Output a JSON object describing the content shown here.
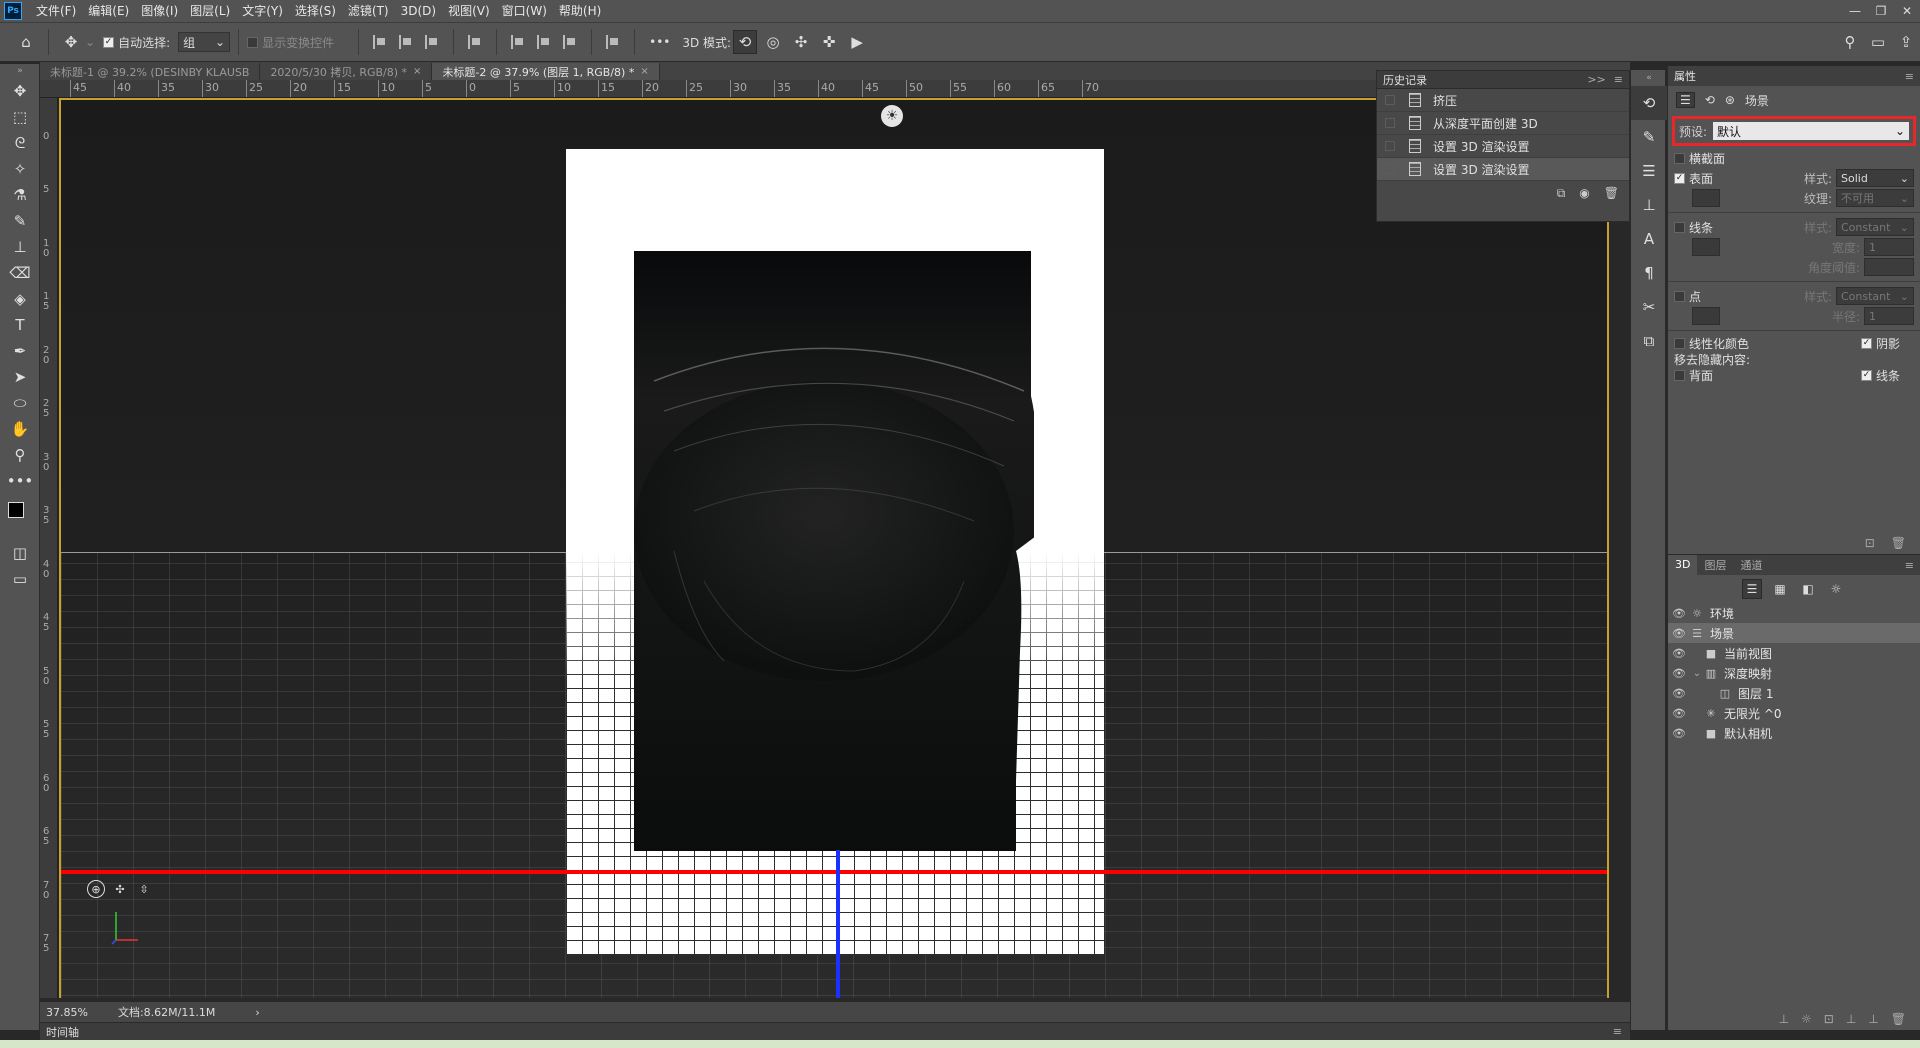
{
  "app": {
    "logo": "Ps"
  },
  "menu": [
    "文件(F)",
    "编辑(E)",
    "图像(I)",
    "图层(L)",
    "文字(Y)",
    "选择(S)",
    "滤镜(T)",
    "3D(D)",
    "视图(V)",
    "窗口(W)",
    "帮助(H)"
  ],
  "window_controls": [
    "—",
    "❐",
    "✕"
  ],
  "options_bar": {
    "auto_select_label": "自动选择:",
    "auto_select_checked": true,
    "group_select": "组",
    "show_transform_label": "显示变换控件",
    "more": "•••",
    "mode_3d_label": "3D 模式:"
  },
  "tabs": [
    {
      "label": "未标题-1 @ 39.2% (DESINBY KLAUSB",
      "active": false
    },
    {
      "label": "2020/5/30 拷贝, RGB/8) *",
      "active": false,
      "close": "×"
    },
    {
      "label": "未标题-2 @ 37.9% (图层 1, RGB/8) *",
      "active": true,
      "close": "×"
    }
  ],
  "ruler_top": [
    "45",
    "40",
    "35",
    "30",
    "25",
    "20",
    "15",
    "10",
    "5",
    "0",
    "5",
    "10",
    "15",
    "20",
    "25",
    "30",
    "35",
    "40",
    "45",
    "50",
    "55",
    "60",
    "65",
    "70"
  ],
  "ruler_left": [
    "5",
    "0",
    "5",
    "1 0",
    "1 5",
    "2 0",
    "2 5",
    "3 0",
    "3 5",
    "4 0",
    "4 5",
    "5 0",
    "5 5",
    "6 0",
    "6 5",
    "7 0",
    "7 5"
  ],
  "history": {
    "title": "历史记录",
    "expand": ">>",
    "menu": "≡",
    "items": [
      {
        "label": "挤压",
        "active": false
      },
      {
        "label": "从深度平面创建 3D",
        "active": false
      },
      {
        "label": "设置 3D 渲染设置",
        "active": false
      },
      {
        "label": "设置 3D 渲染设置",
        "active": true
      }
    ]
  },
  "properties": {
    "title": "属性",
    "menu": "≡",
    "section_label": "场景",
    "preset_label": "预设:",
    "preset_value": "默认",
    "cross_section_label": "横截面",
    "surface": {
      "label": "表面",
      "checked": true,
      "style_label": "样式:",
      "style_value": "Solid",
      "texture_label": "纹理:",
      "texture_value": "不可用"
    },
    "lines": {
      "label": "线条",
      "checked": false,
      "style_label": "样式:",
      "style_value": "Constant",
      "width_label": "宽度:",
      "width_value": "1",
      "angle_label": "角度阈值:"
    },
    "points": {
      "label": "点",
      "checked": false,
      "style_label": "样式:",
      "style_value": "Constant",
      "radius_label": "半径:",
      "radius_value": "1"
    },
    "linearize_label": "线性化颜色",
    "shadow_label": "阴影",
    "remove_hidden_label": "移去隐藏内容:",
    "back_label": "背面",
    "lines_label": "线条"
  },
  "panel_3d": {
    "tabs": [
      "3D",
      "图层",
      "通道"
    ],
    "menu": "≡",
    "items": [
      {
        "label": "环境",
        "icon": "environment-icon",
        "indent": 0,
        "selected": false
      },
      {
        "label": "场景",
        "icon": "scene-icon",
        "indent": 0,
        "selected": true
      },
      {
        "label": "当前视图",
        "icon": "camera-icon",
        "indent": 1,
        "selected": false
      },
      {
        "label": "深度映射",
        "icon": "mesh-icon",
        "indent": 1,
        "selected": false
      },
      {
        "label": "图层 1",
        "icon": "material-icon",
        "indent": 2,
        "selected": false
      },
      {
        "label": "无限光 ^0",
        "icon": "light-icon",
        "indent": 1,
        "selected": false
      },
      {
        "label": "默认相机",
        "icon": "camera-icon",
        "indent": 1,
        "selected": false
      }
    ]
  },
  "status": {
    "zoom": "37.85%",
    "doc": "文档:8.62M/11.1M",
    "arrow": "›"
  },
  "timeline": {
    "label": "时间轴",
    "menu": "≡"
  }
}
